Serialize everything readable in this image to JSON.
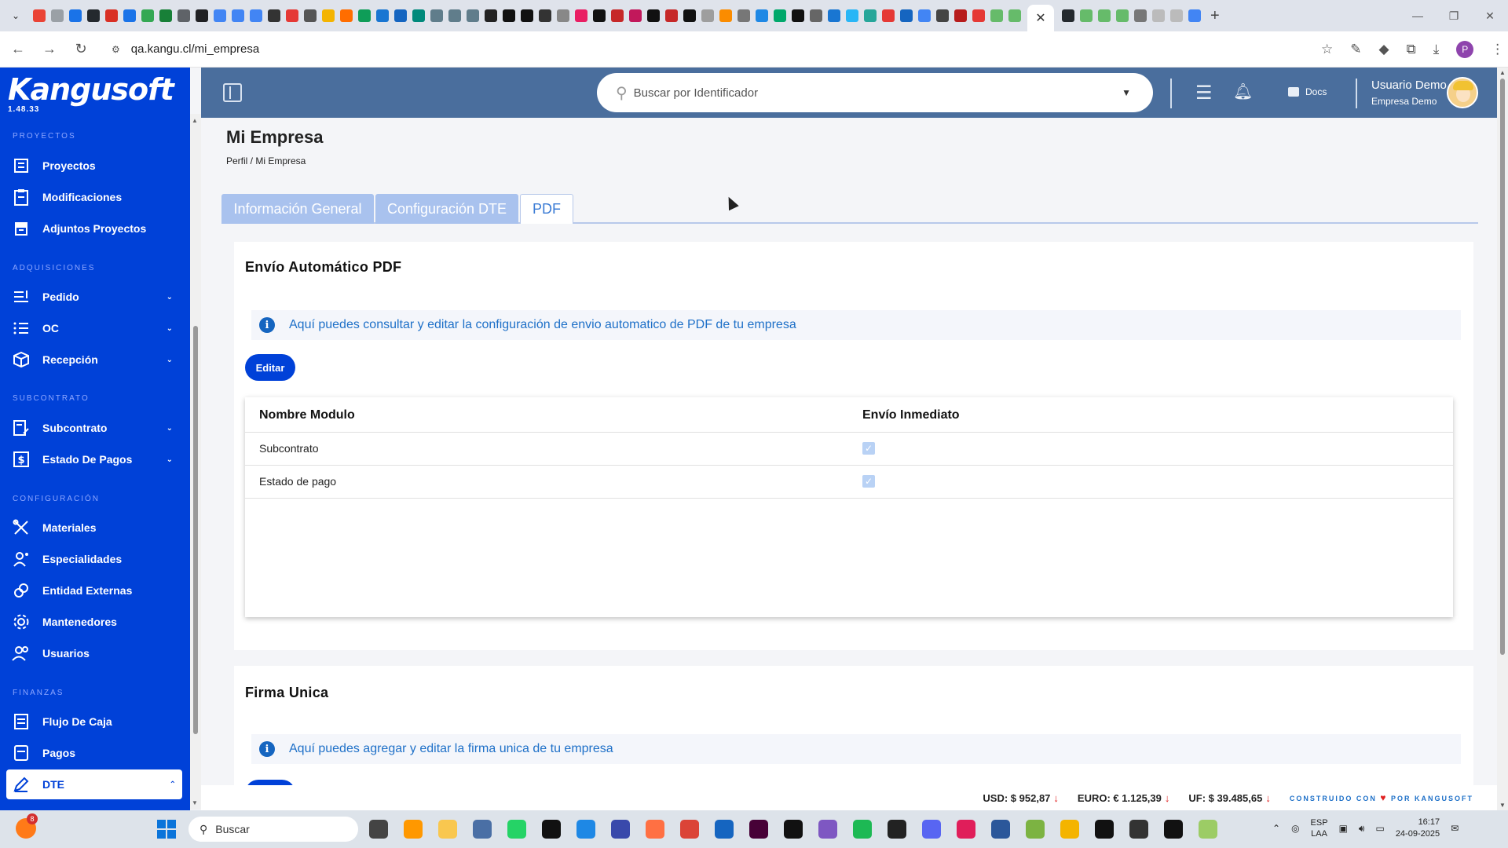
{
  "browser": {
    "url": "qa.kangu.cl/mi_empresa",
    "close_tab_glyph": "✕",
    "new_tab_glyph": "+"
  },
  "sidebar": {
    "logo": "Kangusoft",
    "version": "1.48.33",
    "sections": {
      "proyectos": "PROYECTOS",
      "adquisiciones": "ADQUISICIONES",
      "subcontrato": "SUBCONTRATO",
      "configuracion": "CONFIGURACIÓN",
      "finanzas": "FINANZAS"
    },
    "items": {
      "proyectos": "Proyectos",
      "modificaciones": "Modificaciones",
      "adjuntos": "Adjuntos Proyectos",
      "pedido": "Pedido",
      "oc": "OC",
      "recepcion": "Recepción",
      "subcontrato": "Subcontrato",
      "estado_pagos": "Estado De Pagos",
      "materiales": "Materiales",
      "especialidades": "Especialidades",
      "entidad_externas": "Entidad Externas",
      "mantenedores": "Mantenedores",
      "usuarios": "Usuarios",
      "flujo_caja": "Flujo De Caja",
      "pagos": "Pagos",
      "dte": "DTE"
    }
  },
  "header": {
    "search_placeholder": "Buscar por Identificador",
    "docs_label": "Docs",
    "user_name": "Usuario Demo",
    "company": "Empresa Demo"
  },
  "page": {
    "title": "Mi Empresa",
    "breadcrumb": "Perfil / Mi Empresa",
    "tabs": [
      "Información General",
      "Configuración DTE",
      "PDF"
    ]
  },
  "pdf_section": {
    "title": "Envío Automático PDF",
    "info": "Aquí puedes consultar y editar la configuración de envio automatico de PDF de tu empresa",
    "edit_label": "Editar",
    "columns": [
      "Nombre Modulo",
      "Envío Inmediato"
    ],
    "rows": [
      {
        "name": "Subcontrato",
        "checked": true
      },
      {
        "name": "Estado de pago",
        "checked": true
      }
    ]
  },
  "firma_section": {
    "title": "Firma Unica",
    "info": "Aquí puedes agregar y editar la firma unica de tu empresa"
  },
  "footer": {
    "usd": "USD: $ 952,87",
    "euro": "EURO: € 1.125,39",
    "uf": "UF: $ 39.485,65",
    "built_prefix": "CONSTRUIDO CON",
    "built_suffix": "POR KANGUSOFT"
  },
  "taskbar": {
    "search": "Buscar",
    "badge": "8",
    "lang_top": "ESP",
    "lang_bottom": "LAA",
    "time": "16:17",
    "date": "24-09-2025"
  },
  "colors": {
    "sidebar": "#0041d8",
    "header": "#4a6e9d",
    "info_text": "#1e70c8",
    "button": "#0041d8"
  }
}
